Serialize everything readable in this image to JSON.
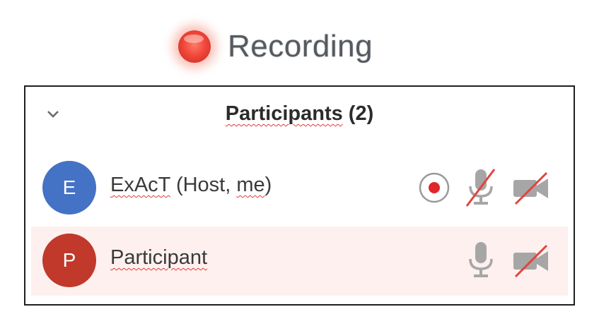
{
  "recording": {
    "label": "Recording",
    "dot_color": "#f0473a"
  },
  "panel": {
    "title_name": "Participants",
    "title_count": "(2)",
    "collapse_icon": "chevron-down-icon"
  },
  "participants": [
    {
      "initial": "E",
      "name_main": "ExAcT",
      "name_suffix": " (Host, ",
      "name_me": "me",
      "name_end": ")",
      "avatar_color": "#4472c4",
      "recording": true,
      "mic_muted": true,
      "video_off": true,
      "highlighted": false
    },
    {
      "initial": "P",
      "name_main": "Participant",
      "avatar_color": "#c0392b",
      "recording": false,
      "mic_muted": false,
      "video_off": true,
      "highlighted": true
    }
  ],
  "colors": {
    "strike": "#e0453d",
    "icon_gray": "#a6a6a6",
    "row_highlight": "#fdf0ee"
  }
}
